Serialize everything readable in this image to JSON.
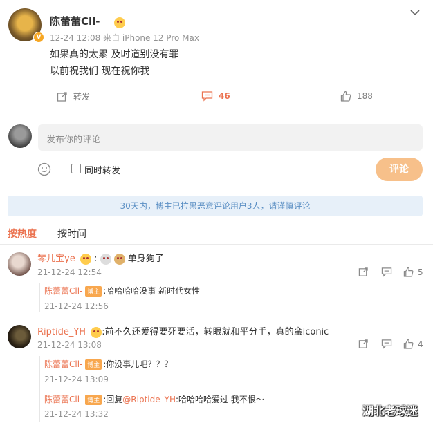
{
  "post": {
    "author": "陈蕾蕾Cll-",
    "meta": "12-24 12:08  来自 iPhone 12 Pro Max",
    "line1": "如果真的太累 及时道别没有罪",
    "line2": "以前祝我们 现在祝你我",
    "repost_label": "转发",
    "comment_count": "46",
    "like_count": "188"
  },
  "composer": {
    "placeholder": "发布你的评论",
    "also_repost": "同时转发",
    "submit": "评论"
  },
  "notice": "30天内，博主已拉黑恶意评论用户3人，请谨慎评论",
  "sort_tabs": [
    "按热度",
    "按时间"
  ],
  "comments": [
    {
      "user": "琴儿宝ye",
      "text": "单身狗了",
      "time": "21-12-24 12:54",
      "likes": "5",
      "replies": [
        {
          "user": "陈蕾蕾Cll-",
          "badge": "博主",
          "text": "哈哈哈哈没事 新时代女性",
          "time": "21-12-24 12:56"
        }
      ]
    },
    {
      "user": "Riptide_YH",
      "text": "前不久还爱得要死要活，转眼就和平分手，真的蛮iconic",
      "time": "21-12-24 13:08",
      "likes": "4",
      "replies": [
        {
          "user": "陈蕾蕾Cll-",
          "badge": "博主",
          "text": "你没事儿吧？？？",
          "time": "21-12-24 13:09"
        },
        {
          "user": "陈蕾蕾Cll-",
          "badge": "博主",
          "prefix": "回复",
          "mention": "@Riptide_YH",
          "text": "哈哈哈哈爱过 我不恨～",
          "time": "21-12-24 13:32"
        }
      ]
    }
  ],
  "watermark": "湖北老球迷",
  "colors": {
    "accent": "#eb7350",
    "button": "#f7c08a",
    "notice_bg": "#e7f0f9",
    "notice_text": "#5b8fc4"
  }
}
